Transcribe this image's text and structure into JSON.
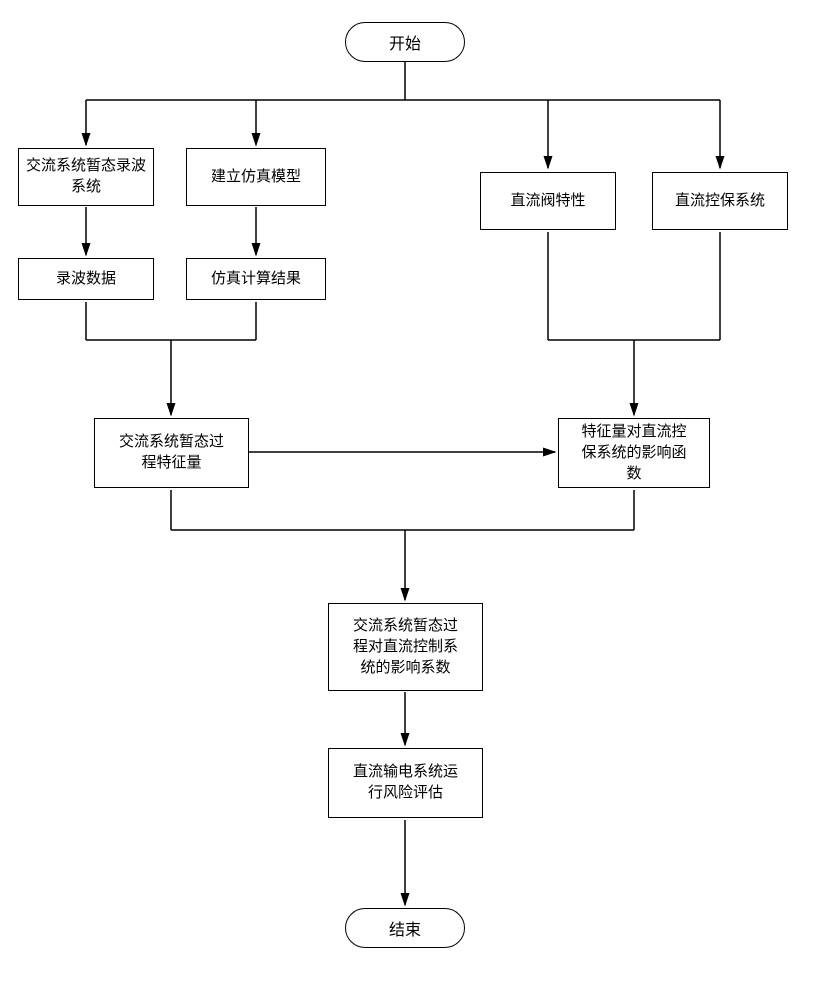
{
  "flowchart": {
    "start": "开始",
    "end": "结束",
    "nodes": {
      "ac_transient_record_sys": "交流系统暂态录波\n系统",
      "build_sim_model": "建立仿真模型",
      "dc_valve_char": "直流阀特性",
      "dc_ctrl_protect_sys": "直流控保系统",
      "record_data": "录波数据",
      "sim_calc_result": "仿真计算结果",
      "ac_transient_feature": "交流系统暂态过\n程特征量",
      "feature_impact_func": "特征量对直流控\n保系统的影响函\n数",
      "ac_transient_impact_coef": "交流系统暂态过\n程对直流控制系\n统的影响系数",
      "dc_transmission_risk": "直流输电系统运\n行风险评估"
    }
  }
}
